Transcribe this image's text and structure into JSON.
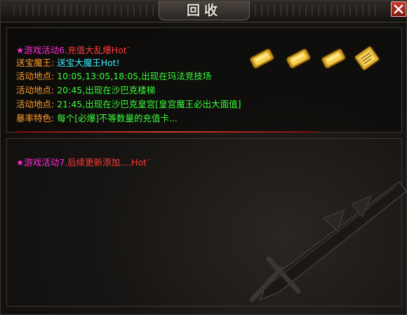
{
  "window": {
    "title": "回收",
    "close_label": "X"
  },
  "event6": {
    "star": "★",
    "title_prefix": "游戏活动6.",
    "title_name": "充值大乱爆",
    "hot": "Hot",
    "boss_label": "送宝魔王:",
    "boss_value": "送宝大魔王",
    "boss_hot": "Hot!",
    "loc1_label": "活动地点:",
    "loc1_value": "10:05,13:05,18:05,出现在玛法竞技场",
    "loc2_label": "活动地点:",
    "loc2_value": "20:45,出现在沙巴克楼梯",
    "loc3_label": "活动地点:",
    "loc3_value": "21:45,出现在沙巴克皇宫[皇宫魔王必出大面值]",
    "drop_label": "暴率特色:",
    "drop_value": "每个[必爆]不等数量的充值卡..."
  },
  "event7": {
    "star": "★",
    "title_prefix": "游戏活动7.",
    "title_name": "后续更新添加....",
    "hot": "Hot"
  },
  "reward_items": [
    {
      "icon": "gold-ingot-icon"
    },
    {
      "icon": "gold-ingot-icon"
    },
    {
      "icon": "gold-ingot-icon"
    },
    {
      "icon": "gold-scroll-icon"
    }
  ],
  "colors": {
    "event_title": "#ff2bd6",
    "event_name": "#ff3b3b",
    "label": "#ff9b2c",
    "value": "#3aff3a",
    "boss": "#3cf0ff"
  }
}
